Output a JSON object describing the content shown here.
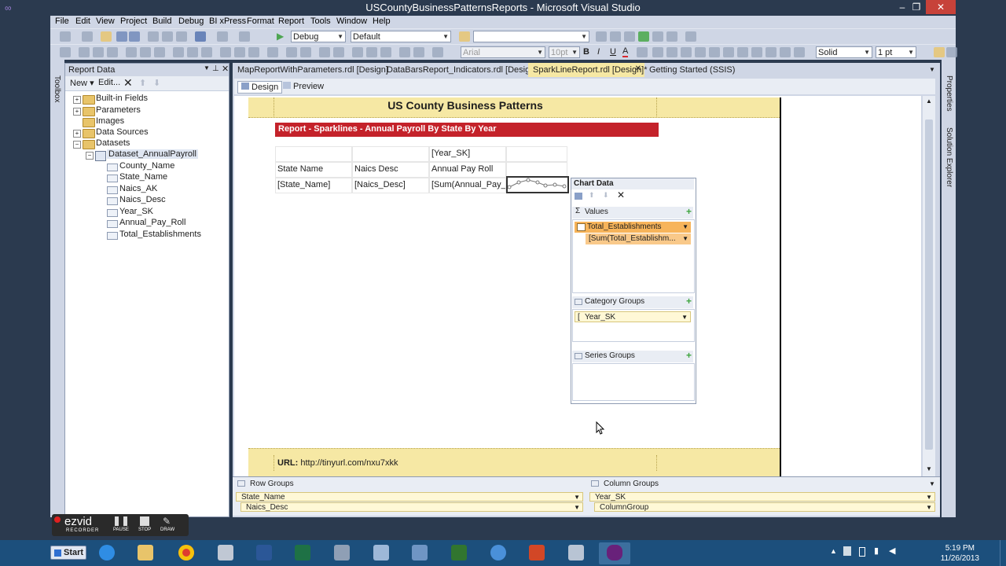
{
  "window": {
    "title": "USCountyBusinessPatternsReports - Microsoft Visual Studio",
    "controls": [
      "minimize",
      "restore",
      "close"
    ]
  },
  "menu": [
    "File",
    "Edit",
    "View",
    "Project",
    "Build",
    "Debug",
    "BI xPress",
    "Format",
    "Report",
    "Tools",
    "Window",
    "Help"
  ],
  "toolbar": {
    "config_combo": "Debug",
    "platform_combo": "Default",
    "search_combo": "",
    "font_combo": "Arial",
    "font_size_combo": "10pt",
    "border_style_combo": "Solid",
    "border_width_combo": "1 pt"
  },
  "left_strip": {
    "toolbox_label": "Toolbox"
  },
  "right_strip": {
    "properties_label": "Properties",
    "solution_explorer_label": "Solution Explorer"
  },
  "report_data": {
    "title": "Report Data",
    "new_label": "New",
    "edit_label": "Edit...",
    "tree": {
      "built_in_fields": "Built-in Fields",
      "parameters": "Parameters",
      "images": "Images",
      "data_sources": "Data Sources",
      "datasets": "Datasets",
      "dataset_name": "Dataset_AnnualPayroll",
      "fields": [
        "County_Name",
        "State_Name",
        "Naics_AK",
        "Naics_Desc",
        "Year_SK",
        "Annual_Pay_Roll",
        "Total_Establishments"
      ]
    }
  },
  "tabs": [
    {
      "label": "MapReportWithParameters.rdl [Design]",
      "active": false
    },
    {
      "label": "DataBarsReport_Indicators.rdl [Design]",
      "active": false
    },
    {
      "label": "SparkLineReport.rdl [Design]*",
      "active": true
    },
    {
      "label": "Getting Started (SSIS)",
      "active": false
    }
  ],
  "design_tabs": {
    "design": "Design",
    "preview": "Preview"
  },
  "report": {
    "header_title": "US County Business Patterns",
    "banner": "Report - Sparklines - Annual Payroll By State By Year",
    "table": {
      "col_group_header": "[Year_SK]",
      "headers": [
        "State Name",
        "Naics Desc",
        "Annual Pay Roll"
      ],
      "detail": [
        "[State_Name]",
        "[Naics_Desc]",
        "[Sum(Annual_Pay_F"
      ]
    },
    "footer_url_label": "URL:",
    "footer_url": "http://tinyurl.com/nxu7xkk"
  },
  "chart_pane": {
    "title": "Chart Data",
    "values_label": "Values",
    "value_series": "Total_Establishments",
    "value_expression": "[Sum(Total_Establishm...",
    "category_groups_label": "Category Groups",
    "category_group": "Year_SK",
    "series_groups_label": "Series Groups"
  },
  "groups_pane": {
    "row_groups_label": "Row Groups",
    "column_groups_label": "Column Groups",
    "row_groups": [
      "State_Name",
      "Naics_Desc"
    ],
    "column_groups": [
      "Year_SK",
      "ColumnGroup"
    ]
  },
  "recorder": {
    "brand": "ezvid",
    "sub": "RECORDER",
    "pause": "PAUSE",
    "stop": "STOP",
    "draw": "DRAW"
  },
  "taskbar": {
    "start_label": "Start",
    "time": "5:19 PM",
    "date": "11/26/2013",
    "apps": [
      "internet-explorer",
      "file-explorer",
      "chrome",
      "paint",
      "word",
      "excel",
      "snipping-tool",
      "paint-brush",
      "remote-desktop",
      "project",
      "powerpoint",
      "calculator",
      "visual-studio"
    ]
  },
  "colors": {
    "vs_chrome": "#cfd6e5",
    "title_bar": "#2b3a4f",
    "report_header": "#f6e8a4",
    "banner": "#c4222a",
    "taskbar": "#1c4f7c",
    "chart_value_highlight": "#f7b45a"
  }
}
